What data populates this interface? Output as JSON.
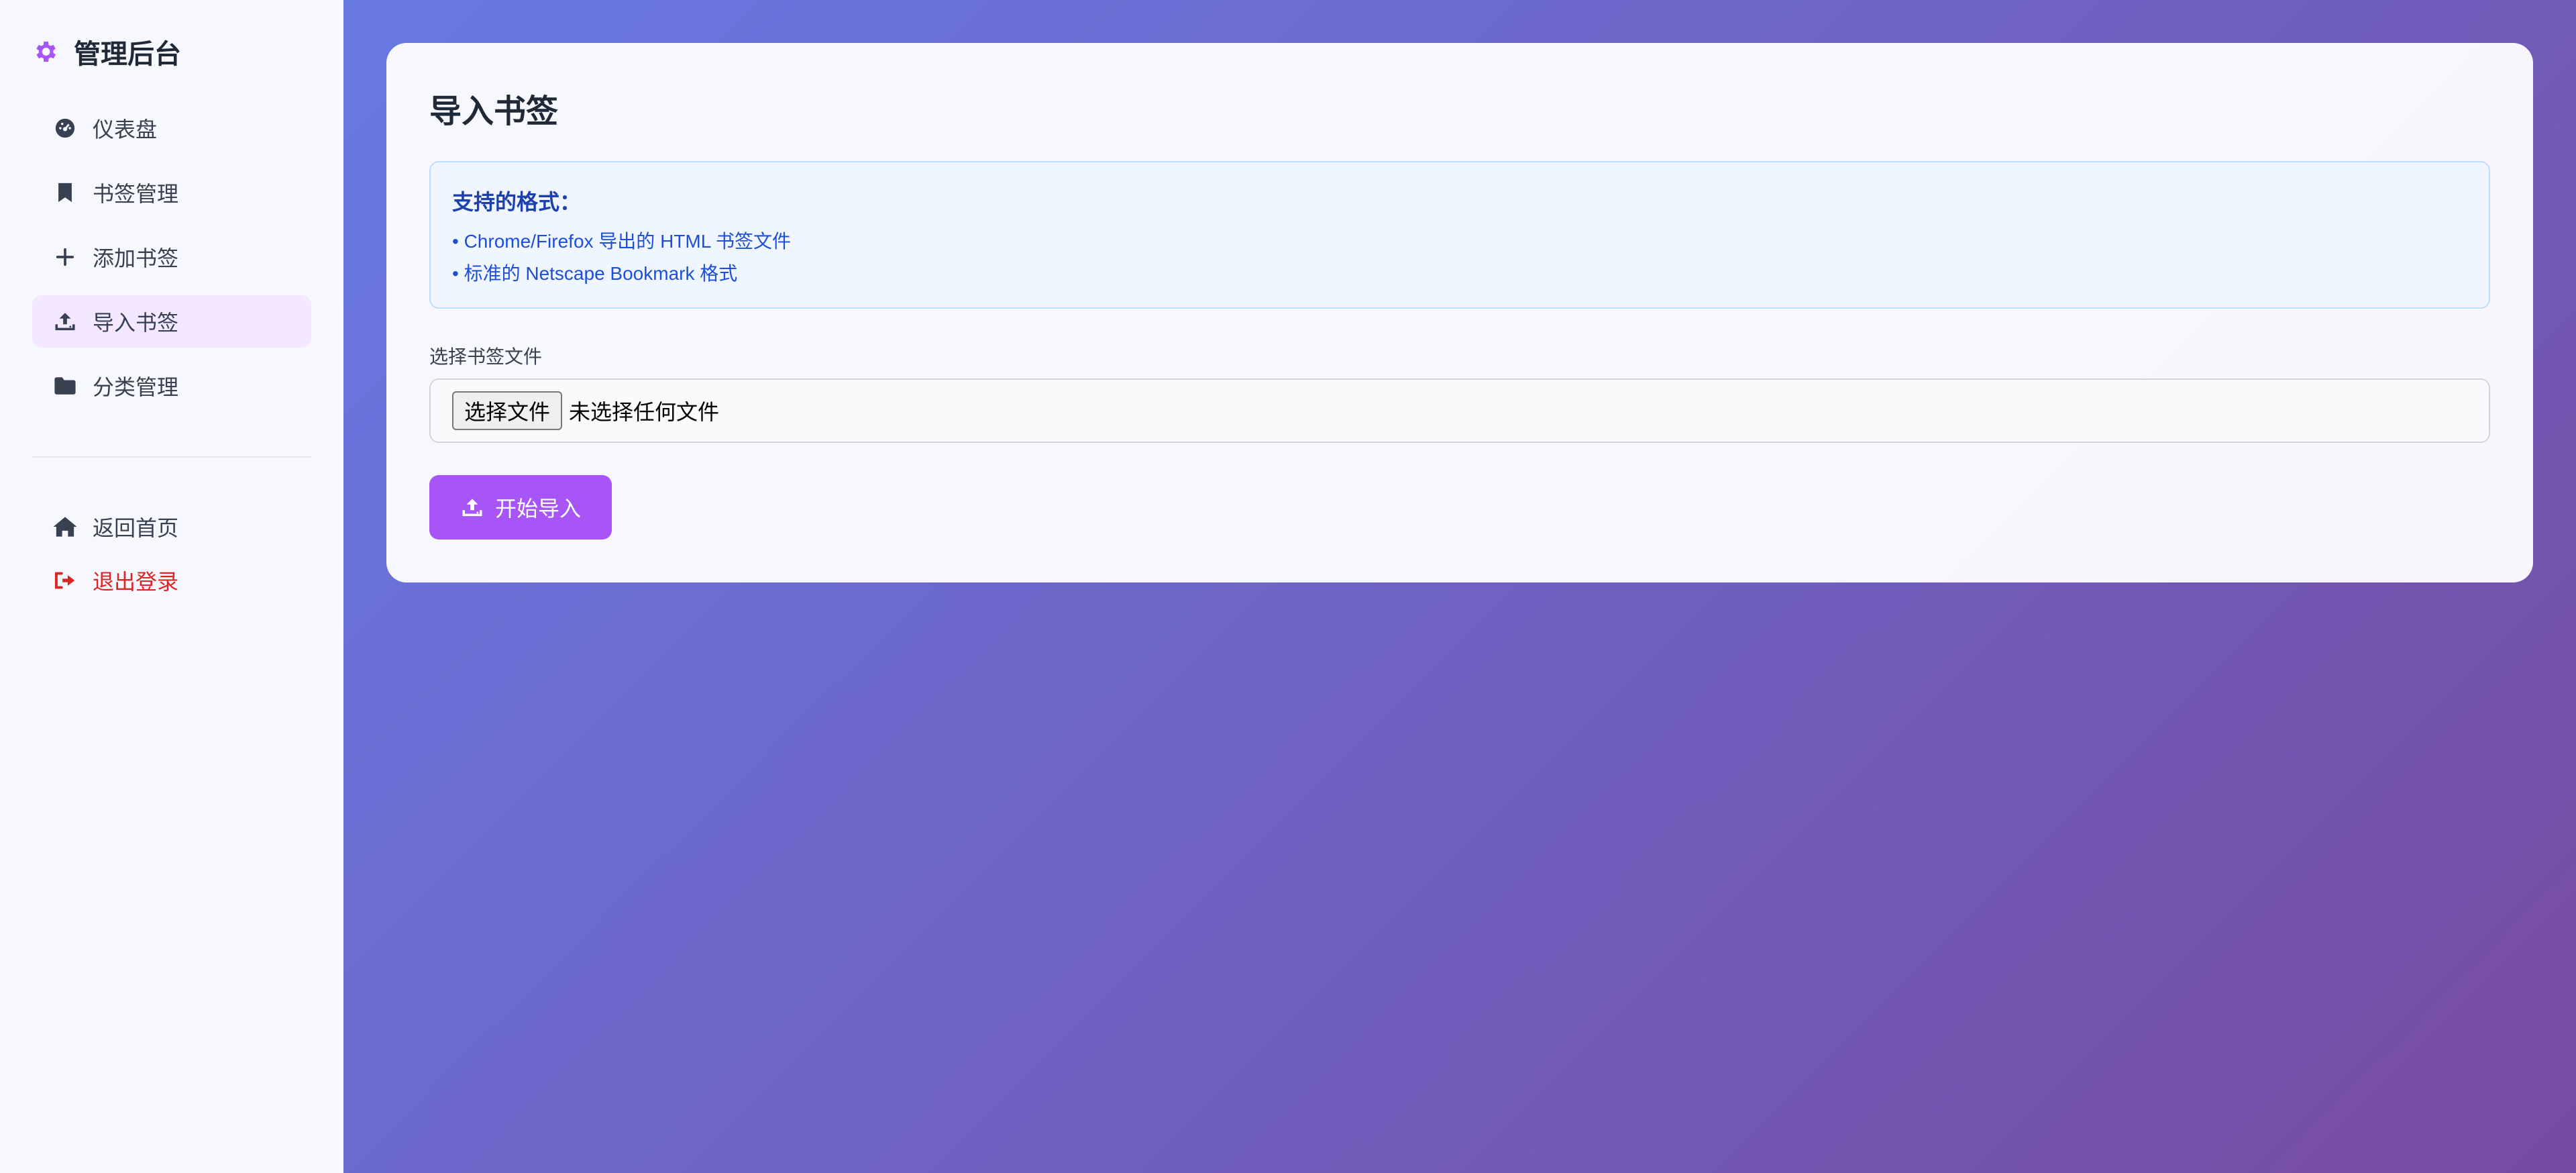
{
  "sidebar": {
    "brand": {
      "icon": "gear-icon",
      "title": "管理后台"
    },
    "nav": [
      {
        "label": "仪表盘",
        "icon": "dashboard-icon"
      },
      {
        "label": "书签管理",
        "icon": "bookmark-icon"
      },
      {
        "label": "添加书签",
        "icon": "plus-icon"
      },
      {
        "label": "导入书签",
        "icon": "upload-icon",
        "active": true
      },
      {
        "label": "分类管理",
        "icon": "folder-icon"
      }
    ],
    "footer": [
      {
        "label": "返回首页",
        "icon": "home-icon"
      },
      {
        "label": "退出登录",
        "icon": "logout-icon"
      }
    ]
  },
  "main": {
    "title": "导入书签",
    "info": {
      "title": "支持的格式：",
      "lines": [
        "• Chrome/Firefox 导出的 HTML 书签文件",
        "• 标准的 Netscape Bookmark 格式"
      ]
    },
    "file": {
      "label": "选择书签文件",
      "button": "选择文件",
      "status": "未选择任何文件"
    },
    "submit": {
      "label": "开始导入",
      "icon": "upload-icon"
    }
  },
  "colors": {
    "accent": "#a855f7",
    "active_bg": "#f3e8ff",
    "info_bg": "#eff6ff",
    "info_text": "#1d4ed8",
    "logout": "#dc2626",
    "gradient_start": "#667eea",
    "gradient_end": "#764ba2"
  }
}
